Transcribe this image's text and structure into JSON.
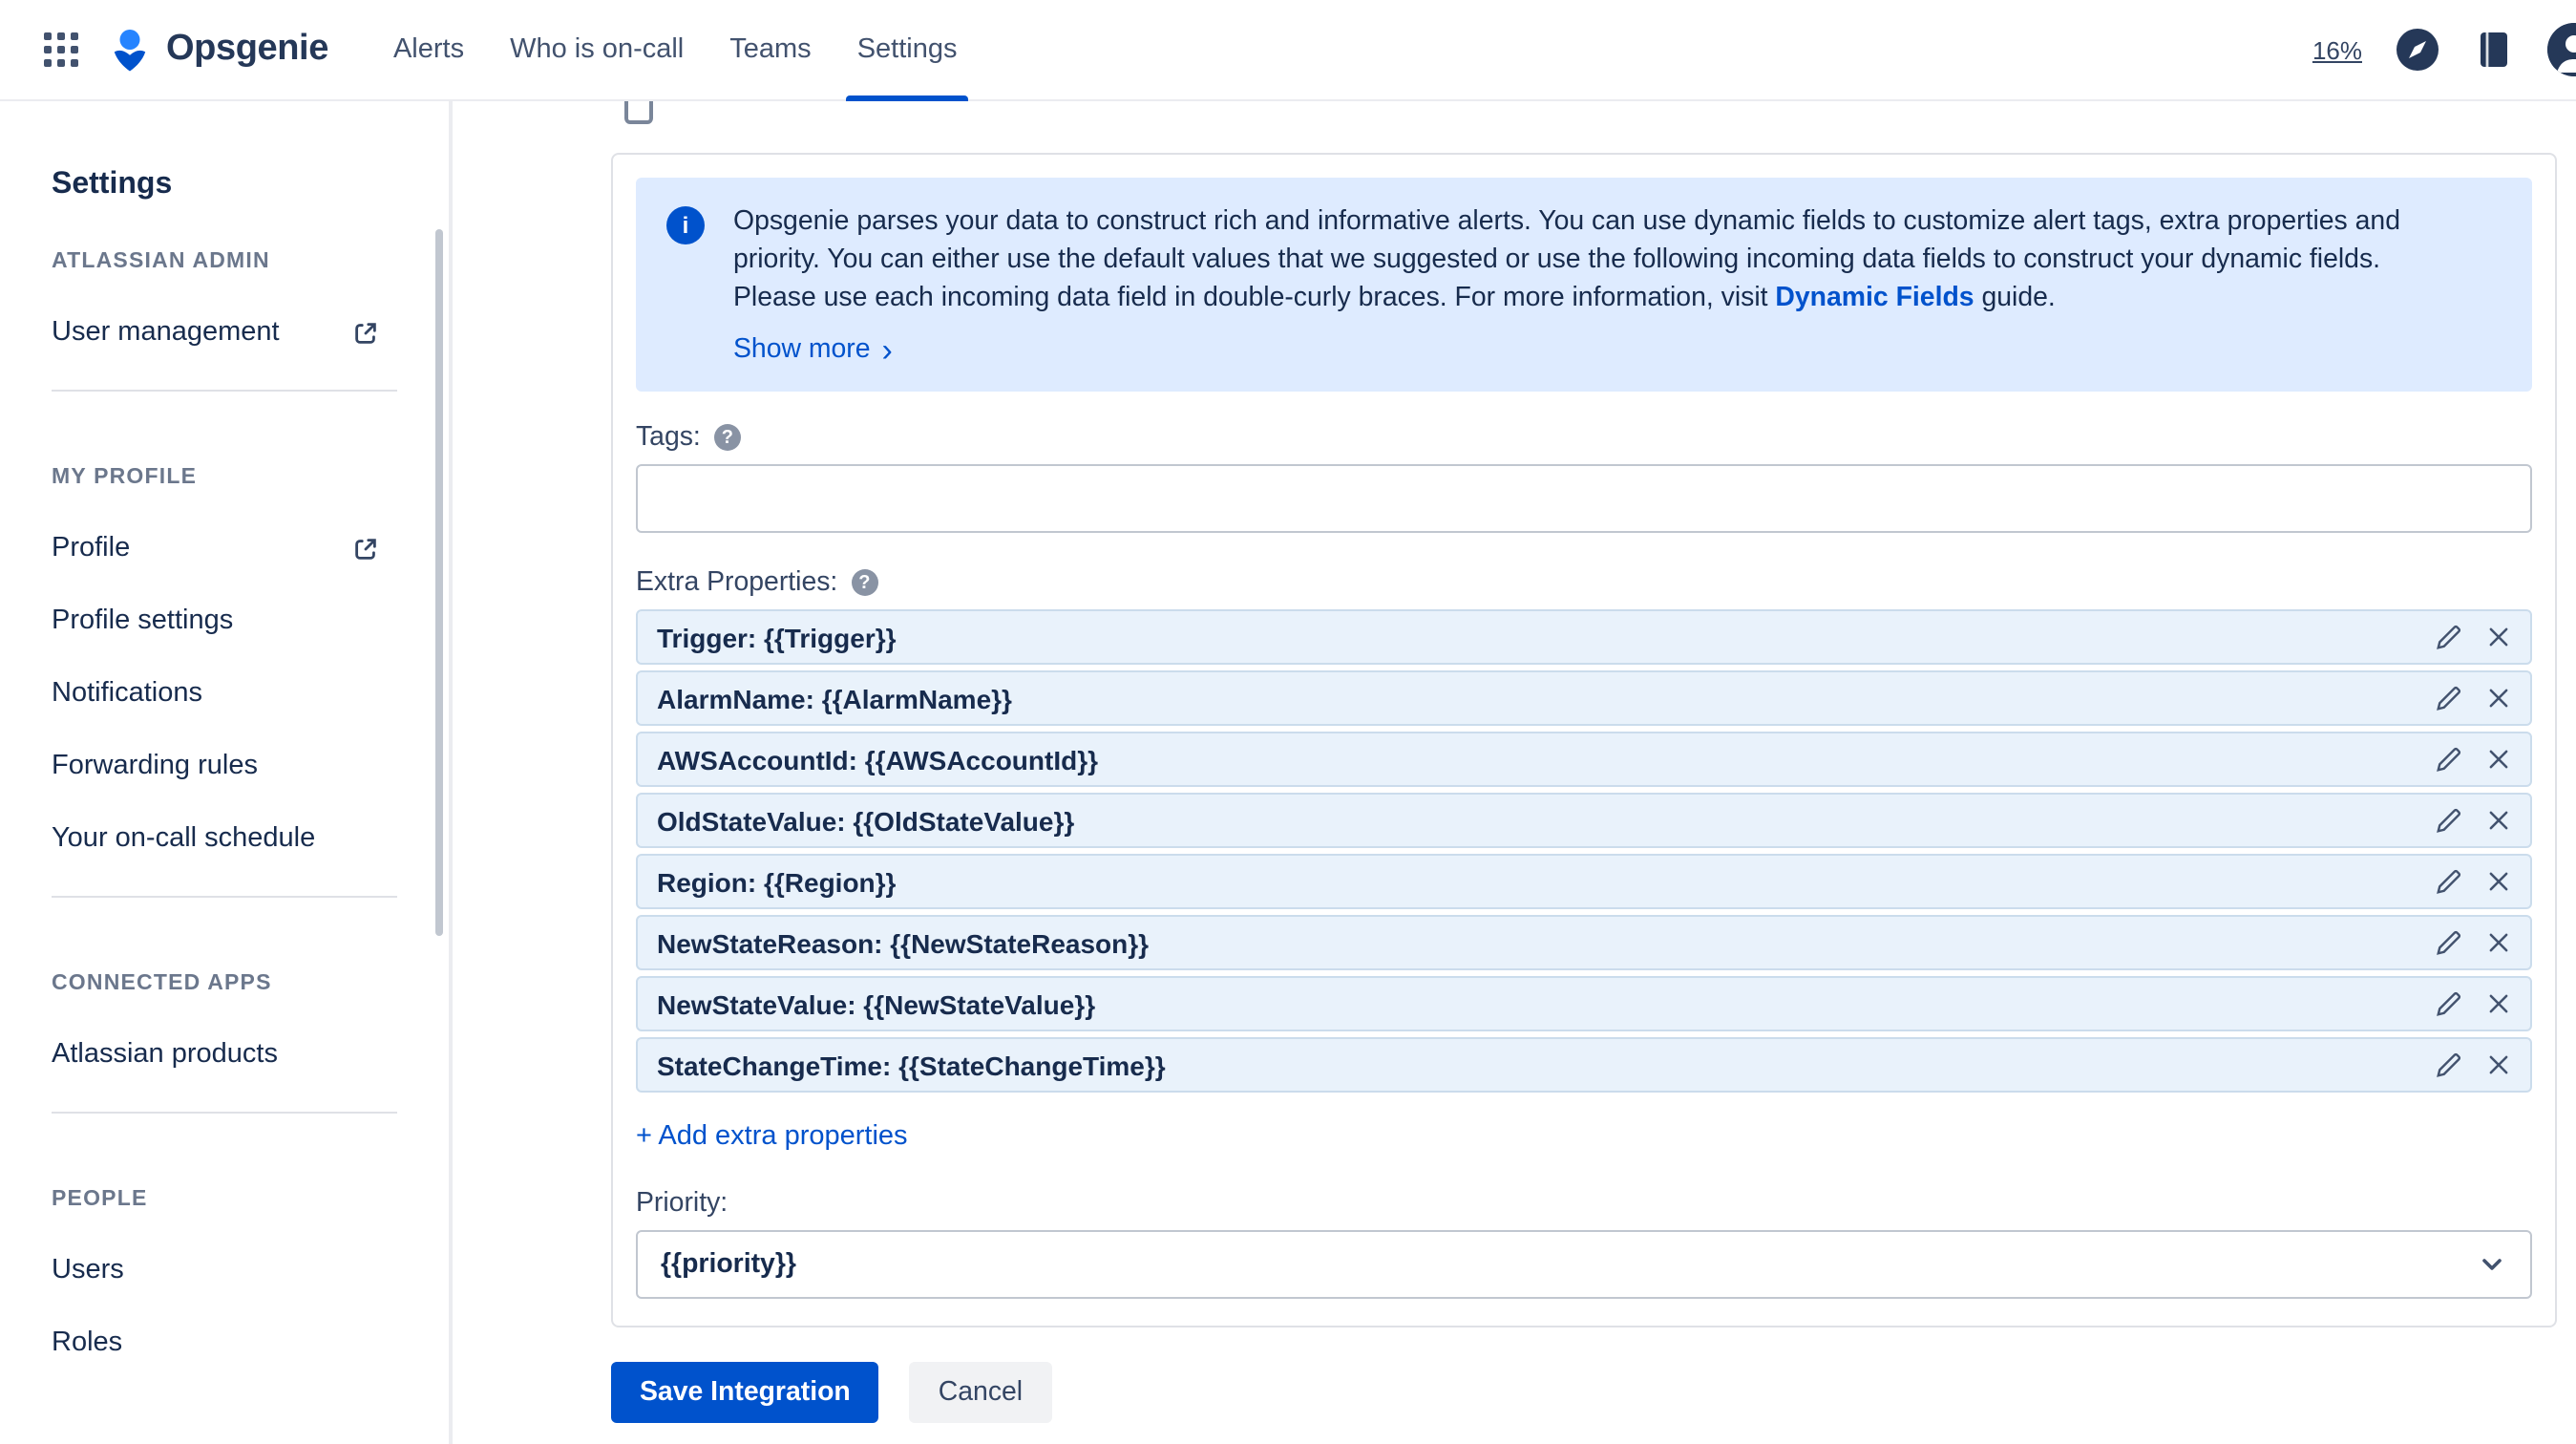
{
  "navbar": {
    "brand": "Opsgenie",
    "items": [
      {
        "label": "Alerts"
      },
      {
        "label": "Who is on-call"
      },
      {
        "label": "Teams"
      },
      {
        "label": "Settings"
      }
    ],
    "usage_percent": "16%"
  },
  "sidebar": {
    "title": "Settings",
    "sections": [
      {
        "heading": "ATLASSIAN ADMIN",
        "items": [
          {
            "label": "User management"
          }
        ]
      },
      {
        "heading": "MY PROFILE",
        "items": [
          {
            "label": "Profile"
          },
          {
            "label": "Profile settings"
          },
          {
            "label": "Notifications"
          },
          {
            "label": "Forwarding rules"
          },
          {
            "label": "Your on-call schedule"
          }
        ]
      },
      {
        "heading": "CONNECTED APPS",
        "items": [
          {
            "label": "Atlassian products"
          }
        ]
      },
      {
        "heading": "PEOPLE",
        "items": [
          {
            "label": "Users"
          },
          {
            "label": "Roles"
          }
        ]
      }
    ]
  },
  "main": {
    "info_banner": {
      "text_before_link": "Opsgenie parses your data to construct rich and informative alerts. You can use dynamic fields to customize alert tags, extra properties and priority. You can either use the default values that we suggested or use the following incoming data fields to construct your dynamic fields. Please use each incoming data field in double-curly braces. For more information, visit ",
      "link_text": "Dynamic Fields",
      "text_after_link": " guide.",
      "show_more_label": "Show more"
    },
    "tags": {
      "label": "Tags:",
      "value": ""
    },
    "extra_properties": {
      "label": "Extra Properties:",
      "rows": [
        "Trigger: {{Trigger}}",
        "AlarmName: {{AlarmName}}",
        "AWSAccountId: {{AWSAccountId}}",
        "OldStateValue: {{OldStateValue}}",
        "Region: {{Region}}",
        "NewStateReason: {{NewStateReason}}",
        "NewStateValue: {{NewStateValue}}",
        "StateChangeTime: {{StateChangeTime}}"
      ],
      "add_label": "+ Add extra properties"
    },
    "priority": {
      "label": "Priority:",
      "value": "{{priority}}"
    },
    "actions": {
      "save_label": "Save Integration",
      "cancel_label": "Cancel"
    }
  },
  "icons": {
    "info": "i",
    "help": "?",
    "chevron_right": "›"
  },
  "colors": {
    "accent": "#0052CC",
    "banner_bg": "#DEEBFF",
    "row_bg": "#E9F2FB"
  }
}
